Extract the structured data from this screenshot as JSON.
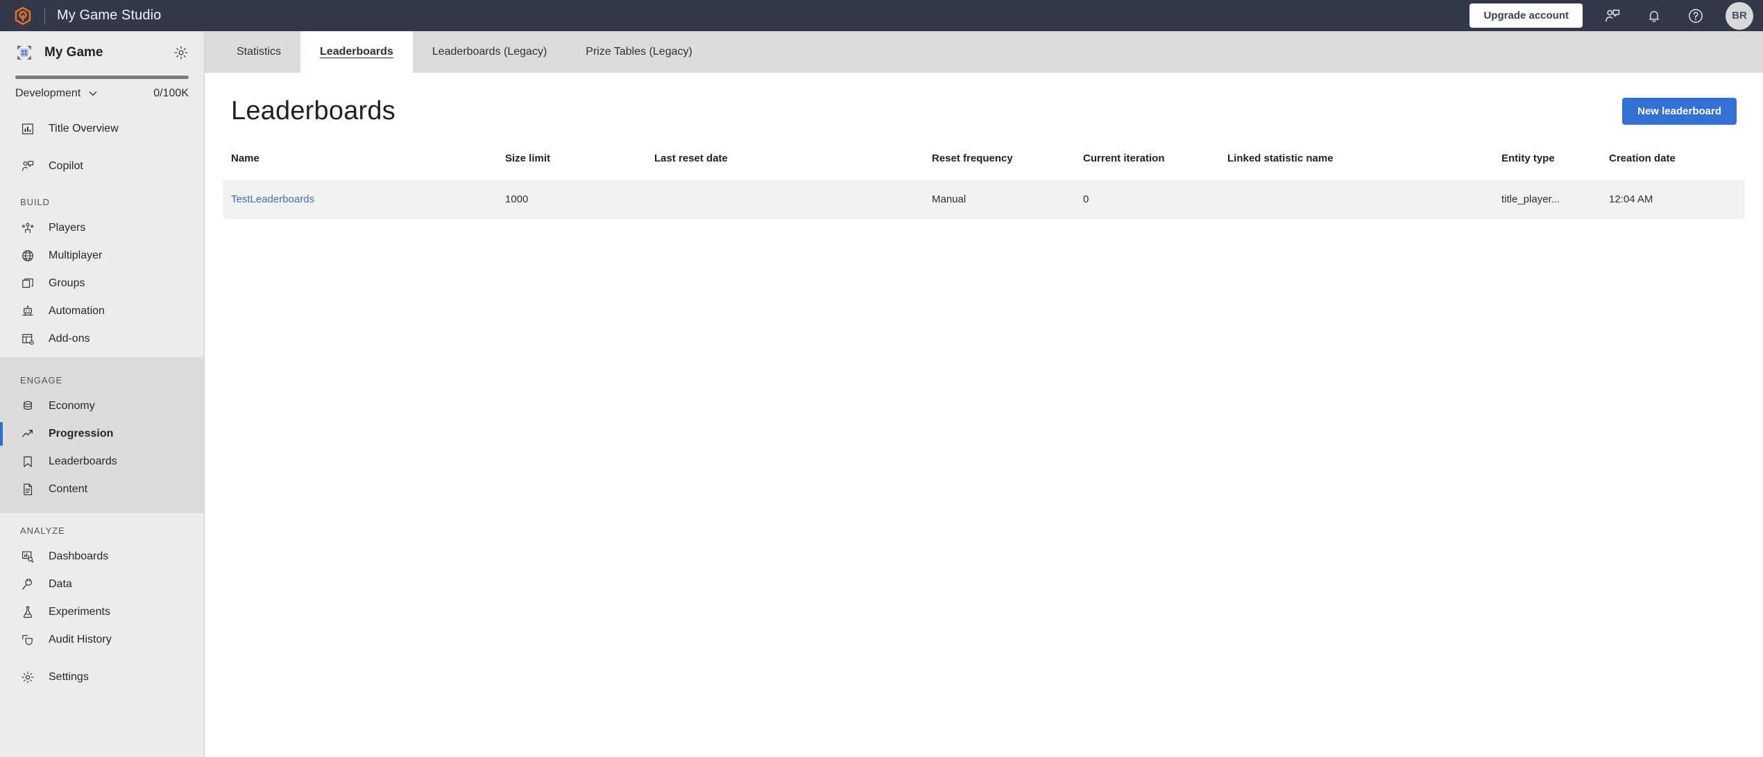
{
  "topbar": {
    "brand_logo_icon": "hexagon-logo-icon",
    "studio_title": "My Game Studio",
    "upgrade_label": "Upgrade account",
    "feedback_icon": "feedback-person-chat-icon",
    "notifications_icon": "bell-icon",
    "help_icon": "question-circle-icon",
    "avatar_initials": "BR"
  },
  "sidebar": {
    "game_icon": "game-grid-icon",
    "game_name": "My Game",
    "settings_gear_icon": "gear-icon",
    "environment": "Development",
    "environment_caret_icon": "chevron-down-icon",
    "quota": "0/100K",
    "top_items": [
      {
        "label": "Title Overview",
        "icon": "bar-chart-icon"
      },
      {
        "label": "Copilot",
        "icon": "person-chat-icon"
      }
    ],
    "sections": [
      {
        "label": "BUILD",
        "items": [
          {
            "label": "Players",
            "icon": "players-icon"
          },
          {
            "label": "Multiplayer",
            "icon": "globe-icon"
          },
          {
            "label": "Groups",
            "icon": "windows-stack-icon"
          },
          {
            "label": "Automation",
            "icon": "robot-icon"
          },
          {
            "label": "Add-ons",
            "icon": "addons-layout-icon"
          }
        ]
      },
      {
        "label": "ENGAGE",
        "items": [
          {
            "label": "Economy",
            "icon": "coins-stack-icon"
          },
          {
            "label": "Progression",
            "icon": "trending-arrow-icon"
          },
          {
            "label": "Leaderboards",
            "icon": "bookmark-icon"
          },
          {
            "label": "Content",
            "icon": "document-icon"
          }
        ]
      },
      {
        "label": "ANALYZE",
        "items": [
          {
            "label": "Dashboards",
            "icon": "dashboard-search-icon"
          },
          {
            "label": "Data",
            "icon": "data-plug-icon"
          },
          {
            "label": "Experiments",
            "icon": "flask-icon"
          },
          {
            "label": "Audit History",
            "icon": "audit-shield-icon"
          }
        ]
      }
    ],
    "footer_items": [
      {
        "label": "Settings",
        "icon": "gear-icon"
      }
    ],
    "active_item": "Progression"
  },
  "tabs": [
    {
      "label": "Statistics"
    },
    {
      "label": "Leaderboards"
    },
    {
      "label": "Leaderboards (Legacy)"
    },
    {
      "label": "Prize Tables (Legacy)"
    }
  ],
  "active_tab_index": 1,
  "page": {
    "title": "Leaderboards",
    "new_button_label": "New leaderboard"
  },
  "table": {
    "columns": [
      "Name",
      "Size limit",
      "Last reset date",
      "Reset frequency",
      "Current iteration",
      "Linked statistic name",
      "Entity type",
      "Creation date"
    ],
    "rows": [
      {
        "name": "TestLeaderboards",
        "size_limit": "1000",
        "last_reset_date": "",
        "reset_frequency": "Manual",
        "current_iteration": "0",
        "linked_statistic_name": "",
        "entity_type": "title_player...",
        "creation_date": "12:04 AM"
      }
    ]
  },
  "colors": {
    "topbar_bg": "#323a49",
    "accent_orange": "#f2702a",
    "primary_blue": "#3372d4",
    "active_rail_blue": "#2e6fd0",
    "link_blue": "#3c6fc4",
    "sidebar_bg": "#ececec",
    "engage_bg": "#dcdcdc",
    "tabbar_bg": "#dcdcdc",
    "row_bg": "#f2f2f1"
  }
}
